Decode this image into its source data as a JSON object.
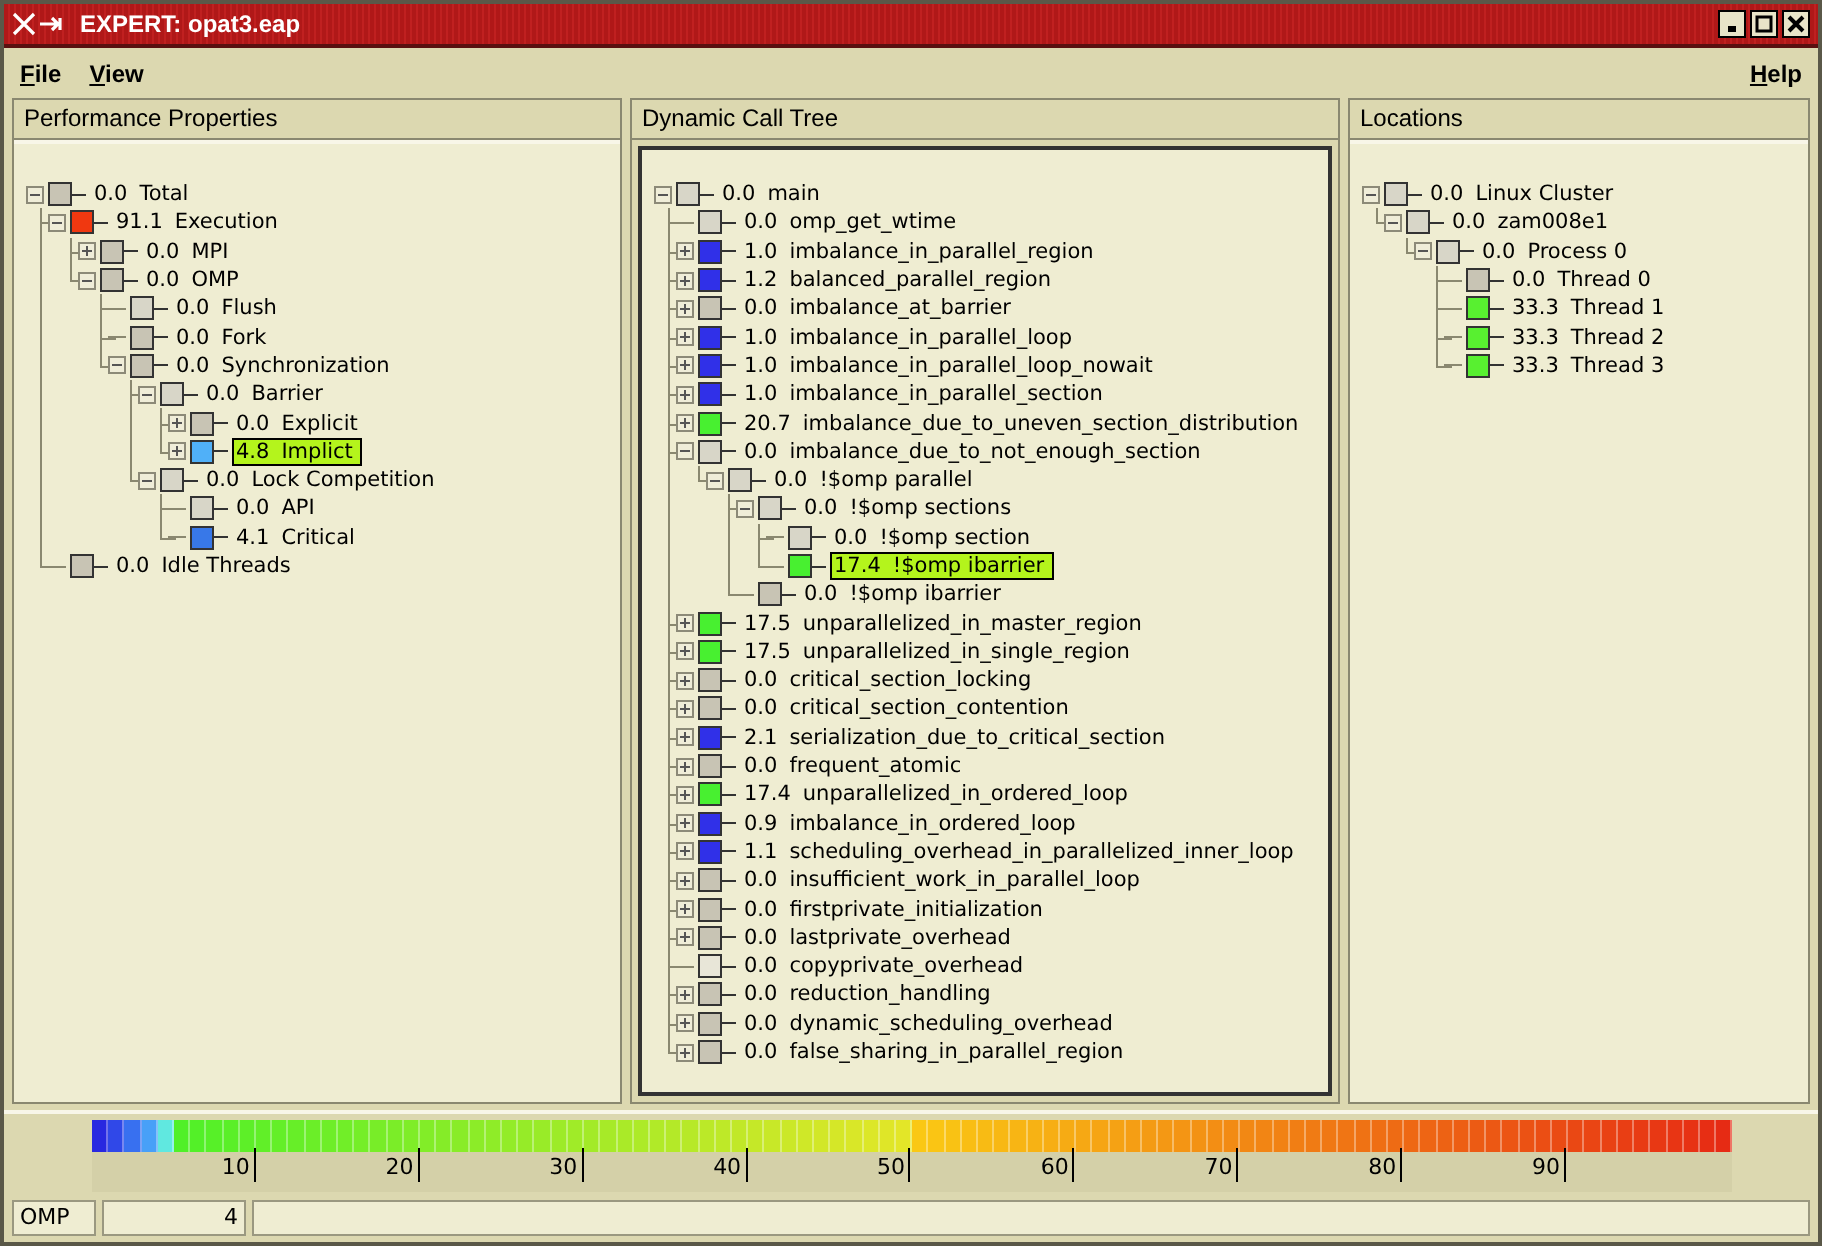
{
  "window": {
    "title": "EXPERT: opat3.eap"
  },
  "menu": [
    {
      "label": "File"
    },
    {
      "label": "View"
    },
    {
      "label": "Help"
    }
  ],
  "panels": [
    {
      "title": "Performance Properties",
      "focused": false,
      "tree": [
        {
          "severity": "0.0",
          "name": "Total",
          "color": "#c8c4b4",
          "kind": "expanded",
          "selected": false,
          "children": [
            {
              "severity": "91.1",
              "name": "Execution",
              "color": "#f03810",
              "kind": "expanded",
              "selected": false,
              "children": [
                {
                  "severity": "0.0",
                  "name": "MPI",
                  "color": "#c8c4b4",
                  "kind": "collapsed",
                  "selected": false
                },
                {
                  "severity": "0.0",
                  "name": "OMP",
                  "color": "#c8c4b4",
                  "kind": "expanded",
                  "selected": false,
                  "children": [
                    {
                      "severity": "0.0",
                      "name": "Flush",
                      "color": "#d8d6c8",
                      "kind": "leaf",
                      "selected": false
                    },
                    {
                      "severity": "0.0",
                      "name": "Fork",
                      "color": "#c8c4b4",
                      "kind": "leaf",
                      "selected": false
                    },
                    {
                      "severity": "0.0",
                      "name": "Synchronization",
                      "color": "#c8c4b4",
                      "kind": "expanded",
                      "selected": false,
                      "children": [
                        {
                          "severity": "0.0",
                          "name": "Barrier",
                          "color": "#d8d6c8",
                          "kind": "expanded",
                          "selected": false,
                          "children": [
                            {
                              "severity": "0.0",
                              "name": "Explicit",
                              "color": "#c8c4b4",
                              "kind": "collapsed",
                              "selected": false
                            },
                            {
                              "severity": "4.8",
                              "name": "Implict",
                              "color": "#50b0f8",
                              "kind": "collapsed",
                              "selected": true
                            }
                          ]
                        },
                        {
                          "severity": "0.0",
                          "name": "Lock Competition",
                          "color": "#d8d6c8",
                          "kind": "expanded",
                          "selected": false,
                          "children": [
                            {
                              "severity": "0.0",
                              "name": "API",
                              "color": "#d8d6c8",
                              "kind": "leaf",
                              "selected": false
                            },
                            {
                              "severity": "4.1",
                              "name": "Critical",
                              "color": "#3878e8",
                              "kind": "leaf",
                              "selected": false
                            }
                          ]
                        }
                      ]
                    }
                  ]
                }
              ]
            },
            {
              "severity": "0.0",
              "name": "Idle Threads",
              "color": "#c8c4b4",
              "kind": "leaf",
              "selected": false
            }
          ]
        }
      ]
    },
    {
      "title": "Dynamic Call Tree",
      "focused": true,
      "tree": [
        {
          "severity": "0.0",
          "name": "main",
          "color": "#d8d6c8",
          "kind": "expanded",
          "selected": false,
          "children": [
            {
              "severity": "0.0",
              "name": "omp_get_wtime",
              "color": "#d8d6c8",
              "kind": "leaf",
              "selected": false
            },
            {
              "severity": "1.0",
              "name": "imbalance_in_parallel_region",
              "color": "#3030e8",
              "kind": "collapsed",
              "selected": false
            },
            {
              "severity": "1.2",
              "name": "balanced_parallel_region",
              "color": "#3030e8",
              "kind": "collapsed",
              "selected": false
            },
            {
              "severity": "0.0",
              "name": "imbalance_at_barrier",
              "color": "#c8c4b4",
              "kind": "collapsed",
              "selected": false
            },
            {
              "severity": "1.0",
              "name": "imbalance_in_parallel_loop",
              "color": "#3030e8",
              "kind": "collapsed",
              "selected": false
            },
            {
              "severity": "1.0",
              "name": "imbalance_in_parallel_loop_nowait",
              "color": "#3030e8",
              "kind": "collapsed",
              "selected": false
            },
            {
              "severity": "1.0",
              "name": "imbalance_in_parallel_section",
              "color": "#3030e8",
              "kind": "collapsed",
              "selected": false
            },
            {
              "severity": "20.7",
              "name": "imbalance_due_to_uneven_section_distribution",
              "color": "#48f030",
              "kind": "collapsed",
              "selected": false
            },
            {
              "severity": "0.0",
              "name": "imbalance_due_to_not_enough_section",
              "color": "#d8d6c8",
              "kind": "expanded",
              "selected": false,
              "children": [
                {
                  "severity": "0.0",
                  "name": "!$omp parallel",
                  "color": "#d8d6c8",
                  "kind": "expanded",
                  "selected": false,
                  "children": [
                    {
                      "severity": "0.0",
                      "name": "!$omp sections",
                      "color": "#d8d6c8",
                      "kind": "expanded",
                      "selected": false,
                      "children": [
                        {
                          "severity": "0.0",
                          "name": "!$omp section",
                          "color": "#d8d6c8",
                          "kind": "leaf",
                          "selected": false
                        },
                        {
                          "severity": "17.4",
                          "name": "!$omp ibarrier",
                          "color": "#48f030",
                          "kind": "leaf",
                          "selected": true
                        }
                      ]
                    },
                    {
                      "severity": "0.0",
                      "name": "!$omp ibarrier",
                      "color": "#c8c4b4",
                      "kind": "leaf",
                      "selected": false
                    }
                  ]
                }
              ]
            },
            {
              "severity": "17.5",
              "name": "unparallelized_in_master_region",
              "color": "#48f030",
              "kind": "collapsed",
              "selected": false
            },
            {
              "severity": "17.5",
              "name": "unparallelized_in_single_region",
              "color": "#48f030",
              "kind": "collapsed",
              "selected": false
            },
            {
              "severity": "0.0",
              "name": "critical_section_locking",
              "color": "#c8c4b4",
              "kind": "collapsed",
              "selected": false
            },
            {
              "severity": "0.0",
              "name": "critical_section_contention",
              "color": "#c8c4b4",
              "kind": "collapsed",
              "selected": false
            },
            {
              "severity": "2.1",
              "name": "serialization_due_to_critical_section",
              "color": "#3030e8",
              "kind": "collapsed",
              "selected": false
            },
            {
              "severity": "0.0",
              "name": "frequent_atomic",
              "color": "#c8c4b4",
              "kind": "collapsed",
              "selected": false
            },
            {
              "severity": "17.4",
              "name": "unparallelized_in_ordered_loop",
              "color": "#48f030",
              "kind": "collapsed",
              "selected": false
            },
            {
              "severity": "0.9",
              "name": "imbalance_in_ordered_loop",
              "color": "#3030e8",
              "kind": "collapsed",
              "selected": false
            },
            {
              "severity": "1.1",
              "name": "scheduling_overhead_in_parallelized_inner_loop",
              "color": "#3030e8",
              "kind": "collapsed",
              "selected": false
            },
            {
              "severity": "0.0",
              "name": "insufficient_work_in_parallel_loop",
              "color": "#c8c4b4",
              "kind": "collapsed",
              "selected": false
            },
            {
              "severity": "0.0",
              "name": "firstprivate_initialization",
              "color": "#c8c4b4",
              "kind": "collapsed",
              "selected": false
            },
            {
              "severity": "0.0",
              "name": "lastprivate_overhead",
              "color": "#c8c4b4",
              "kind": "collapsed",
              "selected": false
            },
            {
              "severity": "0.0",
              "name": "copyprivate_overhead",
              "color": "#e8e6d8",
              "kind": "leaf",
              "selected": false
            },
            {
              "severity": "0.0",
              "name": "reduction_handling",
              "color": "#c8c4b4",
              "kind": "collapsed",
              "selected": false
            },
            {
              "severity": "0.0",
              "name": "dynamic_scheduling_overhead",
              "color": "#c8c4b4",
              "kind": "collapsed",
              "selected": false
            },
            {
              "severity": "0.0",
              "name": "false_sharing_in_parallel_region",
              "color": "#c8c4b4",
              "kind": "collapsed",
              "selected": false
            }
          ]
        }
      ]
    },
    {
      "title": "Locations",
      "focused": false,
      "tree": [
        {
          "severity": "0.0",
          "name": "Linux Cluster",
          "color": "#d8d6c8",
          "kind": "expanded",
          "selected": false,
          "children": [
            {
              "severity": "0.0",
              "name": "zam008e1",
              "color": "#d8d6c8",
              "kind": "expanded",
              "selected": false,
              "children": [
                {
                  "severity": "0.0",
                  "name": "Process 0",
                  "color": "#d8d6c8",
                  "kind": "expanded",
                  "selected": false,
                  "children": [
                    {
                      "severity": "0.0",
                      "name": "Thread 0",
                      "color": "#c8c4b4",
                      "kind": "leaf",
                      "selected": false
                    },
                    {
                      "severity": "33.3",
                      "name": "Thread 1",
                      "color": "#58f030",
                      "kind": "leaf",
                      "selected": false
                    },
                    {
                      "severity": "33.3",
                      "name": "Thread 2",
                      "color": "#58f030",
                      "kind": "leaf",
                      "selected": false
                    },
                    {
                      "severity": "33.3",
                      "name": "Thread 3",
                      "color": "#58f030",
                      "kind": "leaf",
                      "selected": false
                    }
                  ]
                }
              ]
            }
          ]
        }
      ]
    }
  ],
  "scale": {
    "ticks": [
      "10",
      "20",
      "30",
      "40",
      "50",
      "60",
      "70",
      "80",
      "90"
    ]
  },
  "status_bar": {
    "metric": "OMP",
    "value": "4"
  }
}
